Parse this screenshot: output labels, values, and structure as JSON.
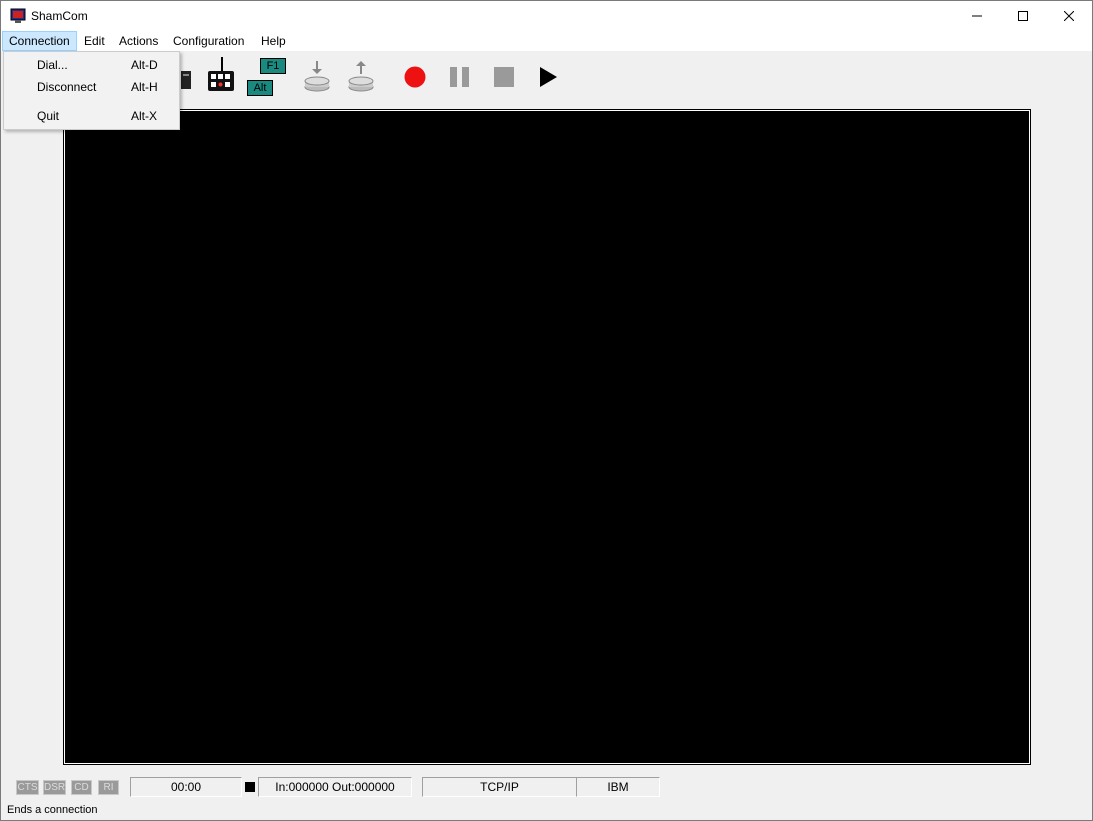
{
  "window": {
    "title": "ShamCom",
    "controls": [
      "minimize-icon",
      "maximize-icon",
      "close-icon"
    ]
  },
  "menubar": {
    "items": [
      {
        "label": "Connection",
        "active": true
      },
      {
        "label": "Edit"
      },
      {
        "label": "Actions"
      },
      {
        "label": "Configuration"
      },
      {
        "label": "Help"
      }
    ]
  },
  "connection_menu": {
    "items": [
      {
        "label": "Dial...",
        "accel": "Alt-D"
      },
      {
        "label": "Disconnect",
        "accel": "Alt-H"
      },
      {
        "label": "Quit",
        "accel": "Alt-X"
      }
    ]
  },
  "toolbar": {
    "key_f1": "F1",
    "key_alt": "Alt",
    "icons": [
      "device-icon",
      "keyboard-icon",
      "f1-key-icon",
      "alt-key-icon",
      "download-icon",
      "upload-icon",
      "record-icon",
      "pause-icon",
      "stop-icon",
      "play-icon"
    ]
  },
  "status": {
    "signals": [
      "CTS",
      "DSR",
      "CD",
      "RI"
    ],
    "timer": "00:00",
    "counters": "In:000000 Out:000000",
    "protocol": "TCP/IP",
    "emulation": "IBM",
    "hint": "Ends a connection"
  },
  "colors": {
    "record": "#ee1111",
    "terminal_bg": "#000000",
    "key_teal": "#1a8a80",
    "menu_highlight": "#cce8ff"
  }
}
